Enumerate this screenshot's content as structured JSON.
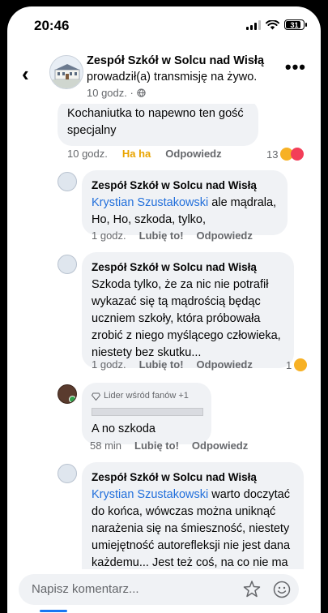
{
  "status_bar": {
    "time": "20:46",
    "battery": "31"
  },
  "header": {
    "title": "Zespół Szkół w Solcu nad Wisłą",
    "subtitle": "prowadził(a) transmisję na żywo.",
    "meta": "10 godz. ·"
  },
  "comments": [
    {
      "text": "Kochaniutka to napewno ten gość specjalny",
      "time": "10 godz.",
      "reaction_label": "Ha ha",
      "reply": "Odpowiedz",
      "reaction_count": "13"
    },
    {
      "author": "Zespół Szkół w Solcu nad Wisłą",
      "mention": "Krystian Szustakowski",
      "text_after_mention": " ale mądrala, Ho, Ho, szkoda, tylko,",
      "time": "1 godz.",
      "like": "Lubię to!",
      "reply": "Odpowiedz"
    },
    {
      "author": "Zespół Szkół w Solcu nad Wisłą",
      "text": "Szkoda tylko, że za nic nie potrafił wykazać się tą mądrością będąc uczniem szkoły, która próbowała zrobić z niego myślącego człowieka, niestety bez skutku...",
      "time": "1 godz.",
      "like": "Lubię to!",
      "reply": "Odpowiedz",
      "reaction_count": "1"
    },
    {
      "badge": "Lider wśród fanów +1",
      "text": "A no szkoda",
      "time": "58 min",
      "like": "Lubię to!",
      "reply": "Odpowiedz"
    },
    {
      "author": "Zespół Szkół w Solcu nad Wisłą",
      "mention": "Krystian Szustakowski",
      "text_after_mention": " warto doczytać do końca, wówczas można uniknąć narażenia się na śmieszność, niestety umiejętność autorefleksji nie jest dana każdemu... Jest też coś, na co nie ma lekarstwa... niestety..."
    }
  ],
  "composer": {
    "placeholder": "Napisz komentarz..."
  },
  "colors": {
    "accent": "#1877f2",
    "mention": "#216fdb",
    "bubble": "#f0f2f5",
    "haha": "#e9a400"
  }
}
